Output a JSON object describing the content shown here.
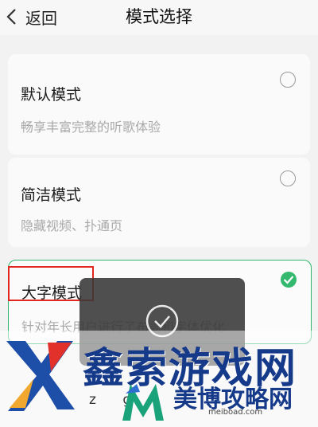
{
  "header": {
    "back_label": "返回",
    "title": "模式选择"
  },
  "modes": [
    {
      "name": "默认模式",
      "desc": "畅享丰富完整的听歌体验",
      "selected": false
    },
    {
      "name": "简洁模式",
      "desc": "隐藏视频、扑通页",
      "selected": false
    },
    {
      "name": "大字模式",
      "desc": "针对年长用户进行了布局和字体优化",
      "selected": true
    }
  ],
  "colors": {
    "accent": "#33b86e",
    "annotation": "#e0281e"
  },
  "toast": {
    "icon": "check-circle-icon"
  },
  "watermark": {
    "main": "鑫索游戏网",
    "zg": "z g",
    "secondary": "美博攻略网",
    "url": "meiboad.com"
  }
}
